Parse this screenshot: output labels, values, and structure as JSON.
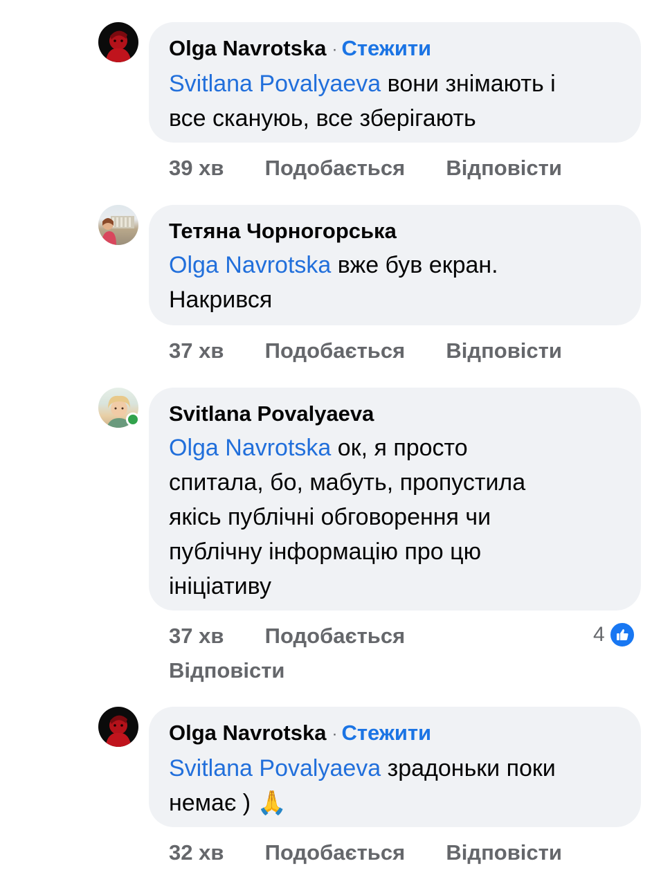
{
  "comments": [
    {
      "author": "Olga Navrotska",
      "follow": "Стежити",
      "mention": "Svitlana Povalyaeva",
      "text_lines": [
        "вони знімають і",
        "все скануюь, все зберігають"
      ],
      "time": "39 хв",
      "like": "Подобається",
      "reply": "Відповісти"
    },
    {
      "author": "Тетяна Чорногорська",
      "mention": "Olga Navrotska",
      "text_lines": [
        "вже був екран.",
        "Накрився"
      ],
      "time": "37 хв",
      "like": "Подобається",
      "reply": "Відповісти"
    },
    {
      "author": "Svitlana Povalyaeva",
      "mention": "Olga Navrotska",
      "text_lines": [
        "ок, я просто",
        "спитала, бо, мабуть, пропустила",
        "якісь публічні обговорення чи",
        "публічну інформацію про цю",
        "ініціативу"
      ],
      "time": "37 хв",
      "like": "Подобається",
      "reply": "Відповісти",
      "reaction_count": "4"
    },
    {
      "author": "Olga Navrotska",
      "follow": "Стежити",
      "mention": "Svitlana Povalyaeva",
      "text_lines": [
        "зрадоньки поки",
        "немає ) 🙏"
      ],
      "time": "32 хв",
      "like": "Подобається",
      "reply": "Відповісти"
    }
  ],
  "icons": {
    "like_badge": "thumbs-up-icon",
    "online": "online-status-dot"
  },
  "colors": {
    "bubble": "#f0f2f5",
    "mention": "#216fdb",
    "follow": "#1b74e4",
    "meta": "#65676b",
    "online": "#31a24c",
    "like": "#1877f2"
  }
}
